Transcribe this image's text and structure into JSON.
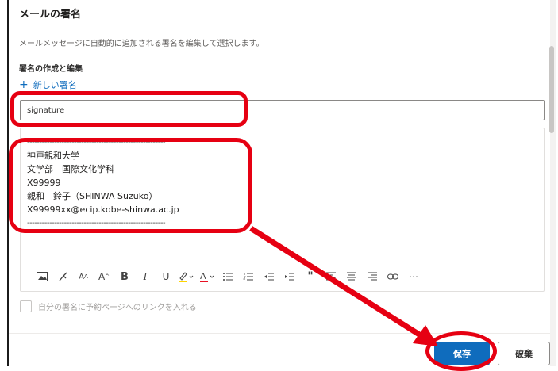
{
  "dialog": {
    "title": "メールの署名",
    "description": "メールメッセージに自動的に追加される署名を編集して選択します。",
    "section_title": "署名の作成と編集",
    "new_signature_label": "新しい署名",
    "signature_name_value": "signature",
    "signature_body": {
      "divider_top": "--------------------------------------------------------",
      "lines": [
        "神戸親和大学",
        "文学部　国際文化学科",
        "X99999",
        "親和　鈴子（SHINWA Suzuko）",
        "X99999xx@ecip.kobe-shinwa.ac.jp"
      ],
      "divider_bottom": "--------------------------------------------------------"
    },
    "toolbar_icons": [
      "image-icon",
      "format-painter-icon",
      "font-size-icon",
      "font-grow-icon",
      "bold-icon",
      "italic-icon",
      "underline-icon",
      "highlight-icon",
      "font-color-icon",
      "bullets-icon",
      "numbering-icon",
      "decrease-indent-icon",
      "increase-indent-icon",
      "quote-icon",
      "align-left-icon",
      "align-center-icon",
      "align-right-icon",
      "link-icon",
      "more-icon"
    ],
    "checkbox_label": "自分の署名に予約ページへのリンクを入れる",
    "save_label": "保存",
    "discard_label": "破棄"
  },
  "colors": {
    "accent": "#0f6cbd",
    "annotation": "#e60012"
  }
}
